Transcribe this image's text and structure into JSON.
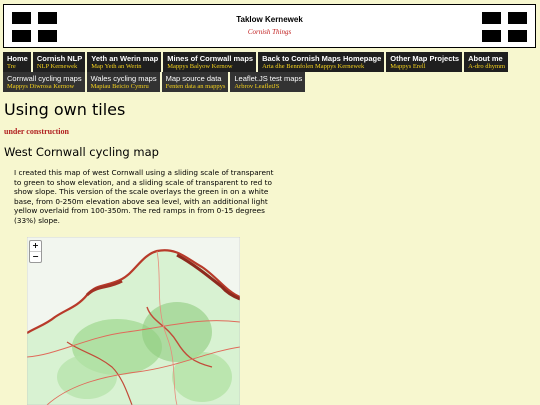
{
  "header": {
    "title": "Taklow Kernewek",
    "subtitle": "Cornish Things",
    "flag_left": "cornish-flag-icon",
    "flag_right": "cornish-flag-icon"
  },
  "nav": {
    "row1": [
      {
        "label": "Home",
        "sub": "Tre"
      },
      {
        "label": "Cornish NLP",
        "sub": "NLP Kernewek"
      },
      {
        "label": "Yeth an Werin map",
        "sub": "Map Yeth an Werin"
      },
      {
        "label": "Mines of Cornwall maps",
        "sub": "Mappys Balyow Kernow"
      },
      {
        "label": "Back to Cornish Maps Homepage",
        "sub": "Arta dhe Bennfolen Mappys Kernewek"
      },
      {
        "label": "Other Map Projects",
        "sub": "Mappys Erell"
      },
      {
        "label": "About me",
        "sub": "A-dro dhymm"
      }
    ],
    "row2": [
      {
        "label": "Cornwall cycling maps",
        "sub": "Mappys Diwrosa Kernow"
      },
      {
        "label": "Wales cycling maps",
        "sub": "Mapiau Beicio Cymru"
      },
      {
        "label": "Map source data",
        "sub": "Fenten data an mappys"
      },
      {
        "label": "Leaflet.JS test maps",
        "sub": "Arbrov LeafletJS"
      }
    ]
  },
  "main": {
    "title": "Using own tiles",
    "status": "under construction",
    "section_title": "West Cornwall cycling map",
    "description": "I created this map of west Cornwall using a sliding scale of transparent to green to show elevation, and a sliding scale of transparent to red to show slope. This version of the scale overlays the green in on a white base, from 0-250m elevation above sea level, with an additional light yellow overlaid from 100-350m. The red ramps in from 0-15 degrees (33%) slope."
  },
  "map": {
    "zoom_in": "+",
    "zoom_out": "−",
    "colors": {
      "low": "#d6f2cf",
      "mid": "#9fd88f",
      "high": "#6fb85a",
      "slope": "#b83a2a",
      "road": "#e06a5a"
    }
  }
}
